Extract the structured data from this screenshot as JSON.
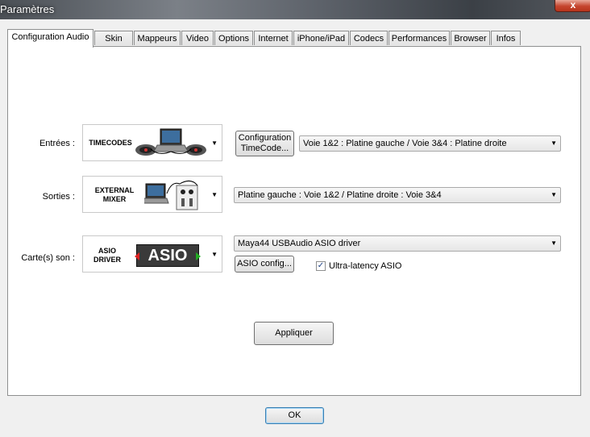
{
  "window": {
    "title": "Paramètres",
    "close_label": "x"
  },
  "tabs": [
    {
      "label": "Configuration Audio",
      "active": true
    },
    {
      "label": "Skin"
    },
    {
      "label": "Mappeurs"
    },
    {
      "label": "Video"
    },
    {
      "label": "Options"
    },
    {
      "label": "Internet"
    },
    {
      "label": "iPhone/iPad"
    },
    {
      "label": "Codecs"
    },
    {
      "label": "Performances"
    },
    {
      "label": "Browser"
    },
    {
      "label": "Infos"
    }
  ],
  "inputs": {
    "label": "Entrées :",
    "picker_text": "TIMECODES",
    "config_button": "Configuration TimeCode...",
    "routing_value": "Voie 1&2 : Platine gauche / Voie 3&4 : Platine droite"
  },
  "outputs": {
    "label": "Sorties :",
    "picker_text": "EXTERNAL MIXER",
    "routing_value": "Platine gauche : Voie 1&2 / Platine droite : Voie 3&4"
  },
  "soundcard": {
    "label": "Carte(s) son :",
    "picker_text": "ASIO DRIVER",
    "logo_text": "ASIO",
    "driver_value": "Maya44 USBAudio ASIO driver",
    "config_button": "ASIO config...",
    "ultra_latency_label": "Ultra-latency ASIO",
    "ultra_latency_checked": true
  },
  "apply_button": "Appliquer",
  "ok_button": "OK",
  "colors": {
    "close": "#c5452e",
    "asio_logo_bg": "#3a3a3a"
  }
}
